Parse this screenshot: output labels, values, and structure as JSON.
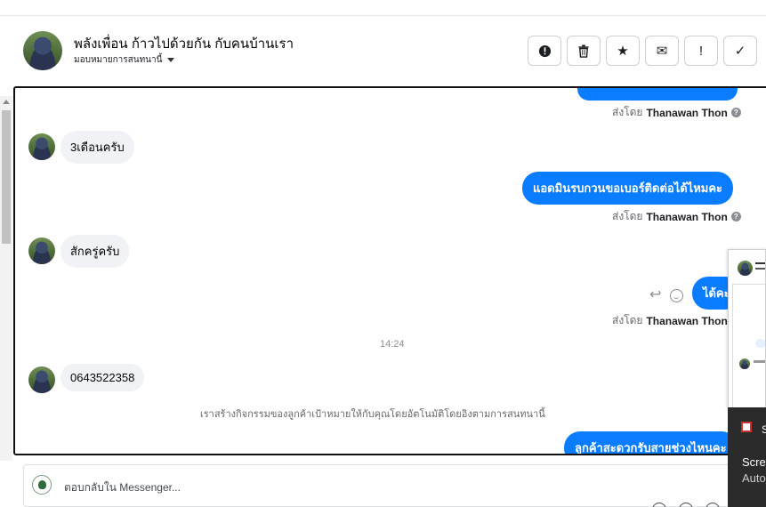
{
  "header": {
    "title": "พลังเพื่อน ก้าวไปด้วยกัน กับคนบ้านเรา",
    "assign_label": "มอบหมายการสนทนานี้"
  },
  "actions": [
    {
      "icon": "alert-circle-icon",
      "glyph": "!"
    },
    {
      "icon": "trash-icon",
      "glyph": ""
    },
    {
      "icon": "star-icon",
      "glyph": "★"
    },
    {
      "icon": "mail-icon",
      "glyph": "✉"
    },
    {
      "icon": "exclamation-icon",
      "glyph": "!"
    },
    {
      "icon": "check-icon",
      "glyph": "✓"
    }
  ],
  "messages": {
    "m0_sent_by_prefix": "ส่งโดย",
    "m0_sent_by_name": "Thanawan Thon",
    "m1_text": "3เดือนครับ",
    "m2_text": "แอดมินรบกวนขอเบอร์ติดต่อได้ไหมคะ",
    "m2_sent_by_prefix": "ส่งโดย",
    "m2_sent_by_name": "Thanawan Thon",
    "m3_text": "สักครู่ครับ",
    "m4_text": "ได้คะ",
    "m4_sent_by_prefix": "ส่งโดย",
    "m4_sent_by_name": "Thanawan Thon",
    "timestamp": "14:24",
    "m5_text": "0643522358",
    "note": "เราสร้างกิจกรรมของลูกค้าเป้าหมายให้กับคุณโดยอัตโนมัติโดยอิงตามการสนทนานี้",
    "m6_text": "ลูกค้าสะดวกรับสายช่วงไหนคะ"
  },
  "reply": {
    "placeholder": "ตอบกลับใน Messenger..."
  },
  "toast": {
    "s": "S",
    "line1": "Scre",
    "line2": "Auto"
  },
  "colors": {
    "accent": "#0a7cff",
    "incoming_bg": "#f0f2f5",
    "meta_text": "#65676b"
  }
}
